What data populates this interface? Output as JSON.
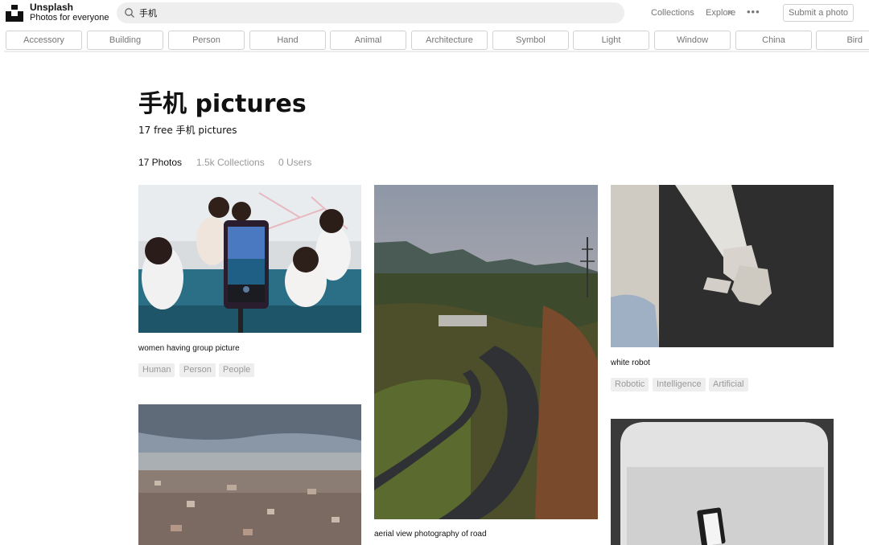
{
  "header": {
    "brand_name": "Unsplash",
    "brand_tagline": "Photos for everyone",
    "search_value": "手机",
    "clear_symbol": "×",
    "nav": [
      {
        "label": "Collections"
      },
      {
        "label": "Explore"
      }
    ],
    "more_symbol": "•••",
    "submit_label": "Submit a photo"
  },
  "categories": [
    "Accessory",
    "Building",
    "Person",
    "Hand",
    "Animal",
    "Architecture",
    "Symbol",
    "Light",
    "Window",
    "China",
    "Bird"
  ],
  "page": {
    "title": "手机 pictures",
    "subtitle": "17 free 手机 pictures",
    "tabs": [
      {
        "label": "17 Photos",
        "active": true
      },
      {
        "label": "1.5k Collections",
        "active": false
      },
      {
        "label": "0 Users",
        "active": false
      }
    ]
  },
  "photos": [
    {
      "caption": "women having group picture",
      "tags": [
        "Human",
        "Person",
        "People"
      ]
    },
    {
      "caption": "aerial view photography of road",
      "tags": []
    },
    {
      "caption": "white robot",
      "tags": [
        "Robotic",
        "Intelligence",
        "Artificial"
      ]
    },
    {
      "caption": "",
      "tags": []
    },
    {
      "caption": "",
      "tags": []
    }
  ],
  "colors": {
    "text_primary": "#111111",
    "text_muted": "#767676",
    "pill_border": "#d1d1d1",
    "search_bg": "#eeeeee",
    "tag_bg": "#eeeeee"
  }
}
